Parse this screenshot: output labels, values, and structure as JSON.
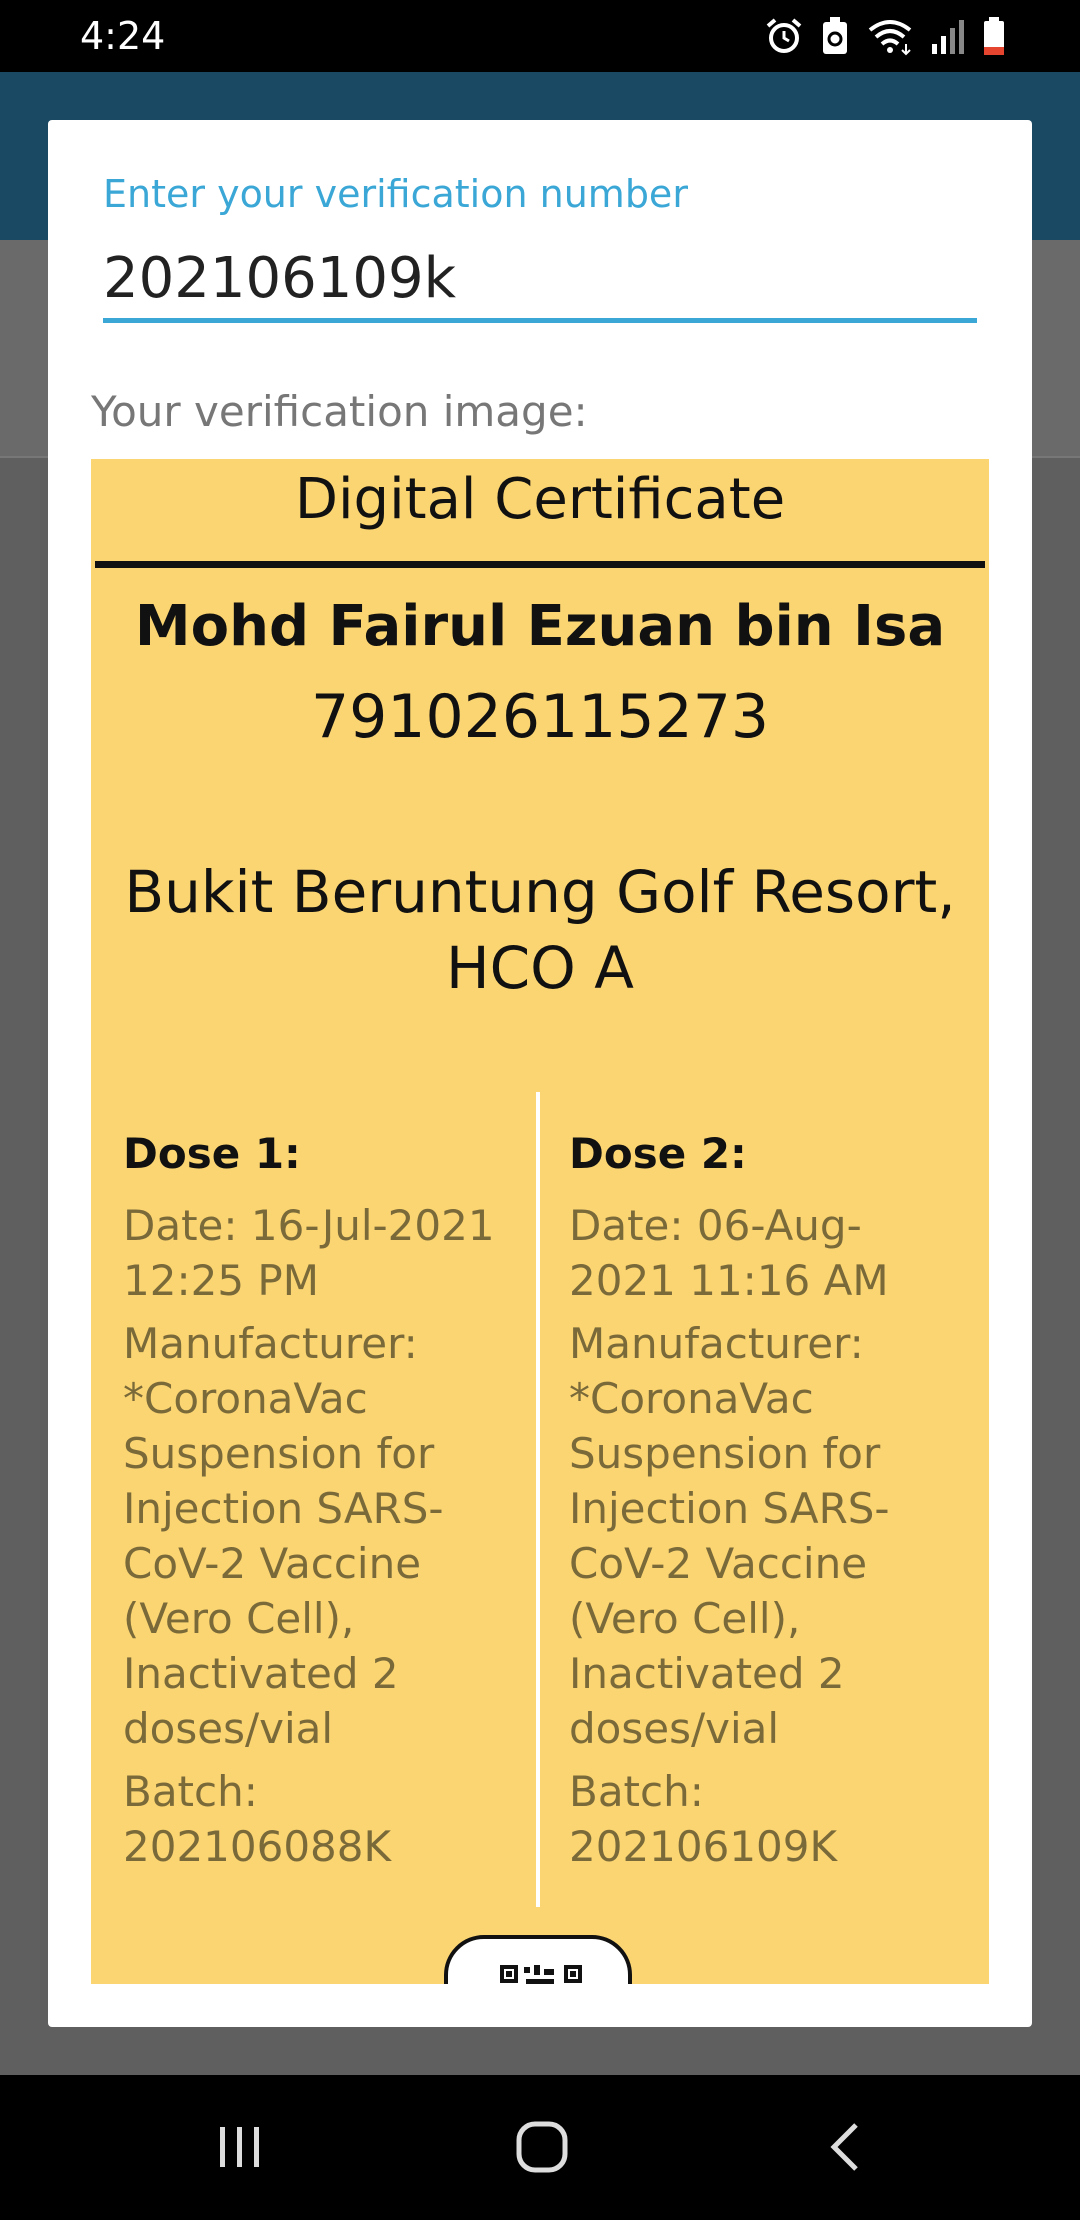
{
  "status_bar": {
    "time": "4:24",
    "icons": [
      "alarm-icon",
      "battery-saver-icon",
      "wifi-icon",
      "signal-icon",
      "battery-icon"
    ]
  },
  "dialog": {
    "input_label": "Enter your verification number",
    "input_value": "202106109k",
    "image_label": "Your verification image:"
  },
  "certificate": {
    "title": "Digital Certificate",
    "name": "Mohd Fairul Ezuan bin Isa",
    "id_number": "791026115273",
    "location_line1": "Bukit Beruntung Golf Resort,",
    "location_line2": "HCO A",
    "doses": [
      {
        "heading": "Dose 1:",
        "date": "Date: 16-Jul-2021 12:25 PM",
        "manufacturer": "Manufacturer: *CoronaVac Suspension for Injection SARS-CoV-2 Vaccine (Vero Cell), Inactivated 2 doses/vial",
        "batch": "Batch: 202106088K"
      },
      {
        "heading": "Dose 2:",
        "date": "Date: 06-Aug-2021 11:16 AM",
        "manufacturer": "Manufacturer: *CoronaVac Suspension for Injection SARS-CoV-2 Vaccine (Vero Cell), Inactivated 2 doses/vial",
        "batch": "Batch: 202106109K"
      }
    ],
    "background_color": "#fbd572"
  },
  "nav_bar": {
    "buttons": [
      "recent-apps-icon",
      "home-icon",
      "back-icon"
    ]
  },
  "colors": {
    "accent": "#3aa7d6",
    "app_header": "#1a4a63"
  }
}
